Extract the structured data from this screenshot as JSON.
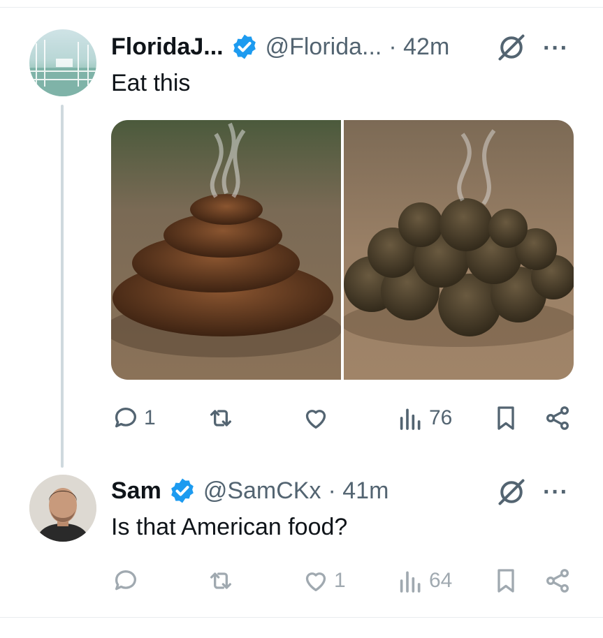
{
  "tweet1": {
    "display_name": "FloridaJ...",
    "handle": "@Florida...",
    "time": "· 42m",
    "text": "Eat this",
    "more": "···",
    "actions": {
      "replies": "1",
      "views": "76"
    },
    "images": [
      {
        "alt": "steaming brown pile on dirt ground"
      },
      {
        "alt": "steaming dark clumps on dirt ground"
      }
    ]
  },
  "tweet2": {
    "display_name": "Sam",
    "handle": "@SamCKx",
    "time": "· 41m",
    "text": "Is that American food?",
    "more": "···",
    "actions": {
      "likes": "1",
      "views": "64"
    }
  },
  "colors": {
    "verified": "#1d9bf0",
    "muted": "#536471",
    "text": "#0f1419"
  },
  "icons": [
    "verified-badge-icon",
    "grok-icon",
    "more-icon",
    "reply-icon",
    "retweet-icon",
    "like-icon",
    "views-icon",
    "bookmark-icon",
    "share-icon"
  ]
}
